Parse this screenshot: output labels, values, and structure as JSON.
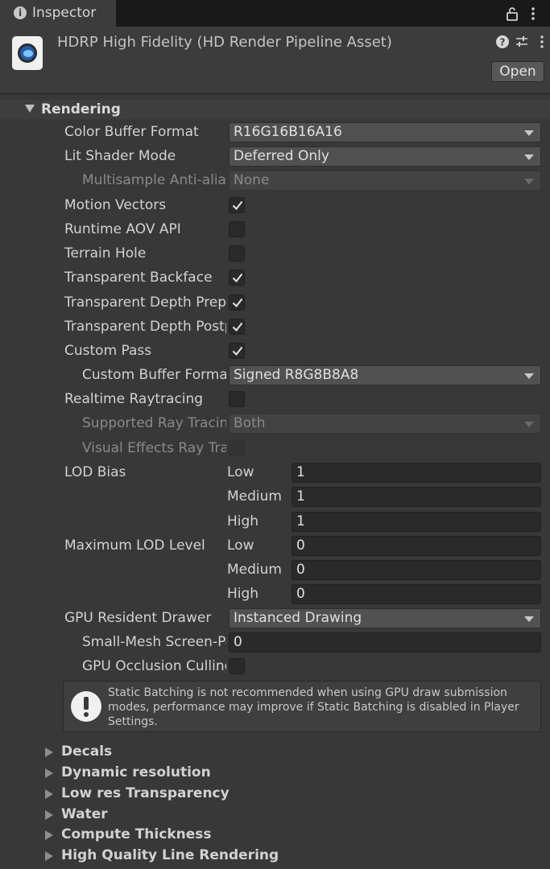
{
  "tab": {
    "title": "Inspector",
    "info_icon": "info-icon"
  },
  "header": {
    "asset_title": "HDRP High Fidelity (HD Render Pipeline Asset)",
    "open_label": "Open"
  },
  "rendering": {
    "section_label": "Rendering",
    "color_buffer_format": {
      "label": "Color Buffer Format",
      "value": "R16G16B16A16"
    },
    "lit_shader_mode": {
      "label": "Lit Shader Mode",
      "value": "Deferred Only"
    },
    "msaa": {
      "label": "Multisample Anti-aliasing",
      "value": "None"
    },
    "motion_vectors": {
      "label": "Motion Vectors",
      "checked": true
    },
    "runtime_aov": {
      "label": "Runtime AOV API",
      "checked": false
    },
    "terrain_hole": {
      "label": "Terrain Hole",
      "checked": false
    },
    "transparent_backface": {
      "label": "Transparent Backface",
      "checked": true
    },
    "transparent_depth_prepass": {
      "label": "Transparent Depth Prepass",
      "checked": true
    },
    "transparent_depth_postpass": {
      "label": "Transparent Depth Postpass",
      "checked": true
    },
    "custom_pass": {
      "label": "Custom Pass",
      "checked": true
    },
    "custom_buffer_format": {
      "label": "Custom Buffer Format",
      "value": "Signed R8G8B8A8"
    },
    "realtime_raytracing": {
      "label": "Realtime Raytracing",
      "checked": false
    },
    "supported_ray_tracing": {
      "label": "Supported Ray Tracing Mode",
      "value": "Both"
    },
    "visual_effects_ray_tracing": {
      "label": "Visual Effects Ray Tracing",
      "checked": false
    },
    "lod_bias": {
      "label": "LOD Bias",
      "levels": [
        {
          "name": "Low",
          "value": "1"
        },
        {
          "name": "Medium",
          "value": "1"
        },
        {
          "name": "High",
          "value": "1"
        }
      ]
    },
    "max_lod_level": {
      "label": "Maximum LOD Level",
      "levels": [
        {
          "name": "Low",
          "value": "0"
        },
        {
          "name": "Medium",
          "value": "0"
        },
        {
          "name": "High",
          "value": "0"
        }
      ]
    },
    "gpu_resident_drawer": {
      "label": "GPU Resident Drawer",
      "value": "Instanced Drawing"
    },
    "small_mesh_culling": {
      "label": "Small-Mesh Screen-Percentage",
      "value": "0"
    },
    "gpu_occlusion_culling": {
      "label": "GPU Occlusion Culling",
      "checked": false
    },
    "help_text": "Static Batching is not recommended when using GPU draw submission modes, performance may improve if Static Batching is disabled in Player Settings."
  },
  "sections": [
    {
      "label": "Decals"
    },
    {
      "label": "Dynamic resolution"
    },
    {
      "label": "Low res Transparency"
    },
    {
      "label": "Water"
    },
    {
      "label": "Compute Thickness"
    },
    {
      "label": "High Quality Line Rendering"
    }
  ],
  "colors": {
    "background": "#383838",
    "tab_bar": "#191919",
    "field": "#2a2a2a",
    "dropdown": "#515151"
  }
}
